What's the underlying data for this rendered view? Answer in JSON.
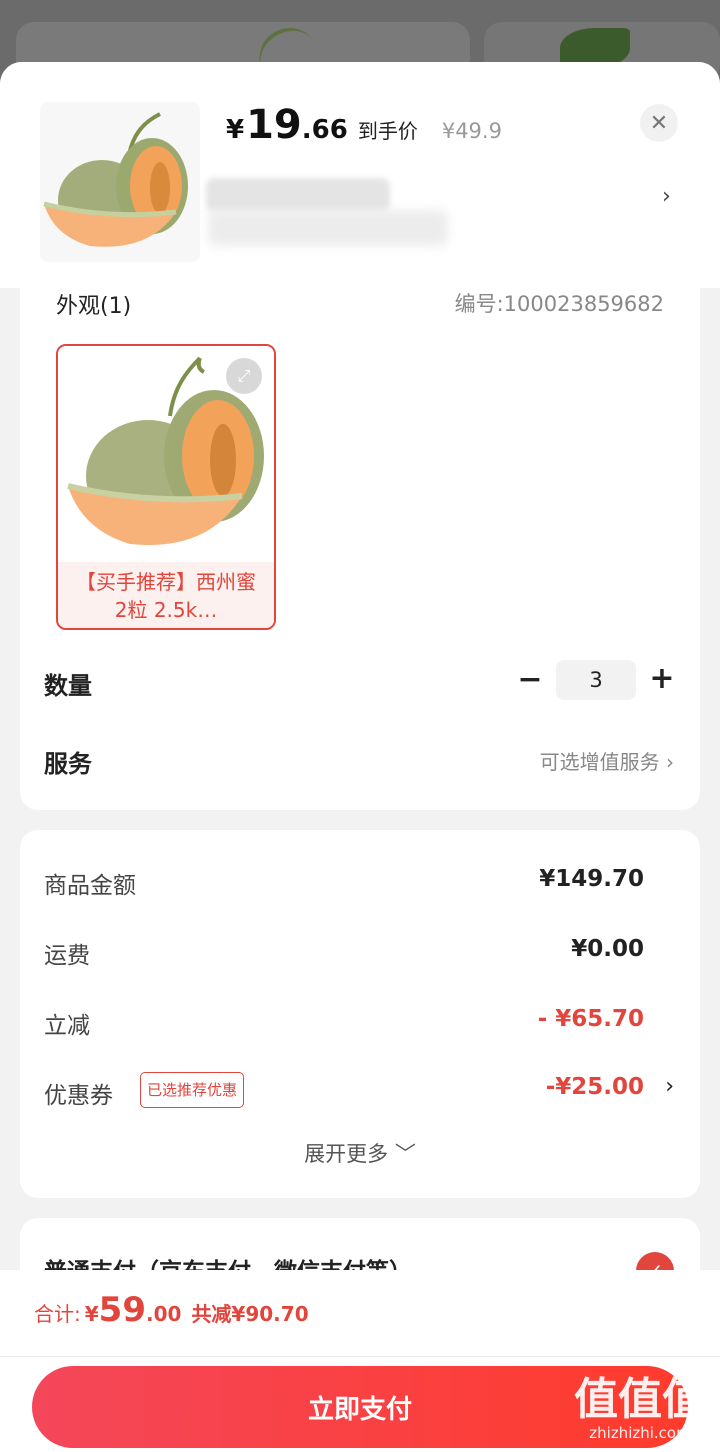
{
  "product": {
    "price_symbol": "¥",
    "price_int": "19",
    "price_dec": ".66",
    "price_tag": "到手价",
    "original_price": "¥49.9",
    "close_icon": "close-icon",
    "chevron": "›"
  },
  "spec": {
    "title": "外观(1)",
    "number": "编号:100023859682",
    "option_label": "【买手推荐】西州蜜 2粒 2.5k…",
    "expand_icon": "expand-icon"
  },
  "quantity": {
    "label": "数量",
    "minus": "−",
    "value": "3",
    "plus": "+"
  },
  "service": {
    "label": "服务",
    "hint": "可选增值服务 ›"
  },
  "fees": {
    "goods_label": "商品金额",
    "goods_value": "¥149.70",
    "shipping_label": "运费",
    "shipping_value": "¥0.00",
    "discount_label": "立减",
    "discount_value": "- ¥65.70",
    "coupon_label": "优惠券",
    "coupon_tag": "已选推荐优惠",
    "coupon_value": "-¥25.00",
    "coupon_chevron": "›",
    "more": "展开更多 ﹀"
  },
  "payment": {
    "method": "普通支付（京东支付、微信支付等）",
    "check": "✓"
  },
  "footer": {
    "total_label": "合计:",
    "total_symbol": "¥",
    "total_int": "59",
    "total_dec": ".00",
    "total_saved": "共减¥90.70",
    "pay_button": "立即支付"
  },
  "watermark": {
    "big": "值值值",
    "small": "zhizhizhi.com"
  },
  "colors": {
    "accent": "#e2453c",
    "button_start": "#f4475a",
    "button_end": "#ff3b2c"
  }
}
